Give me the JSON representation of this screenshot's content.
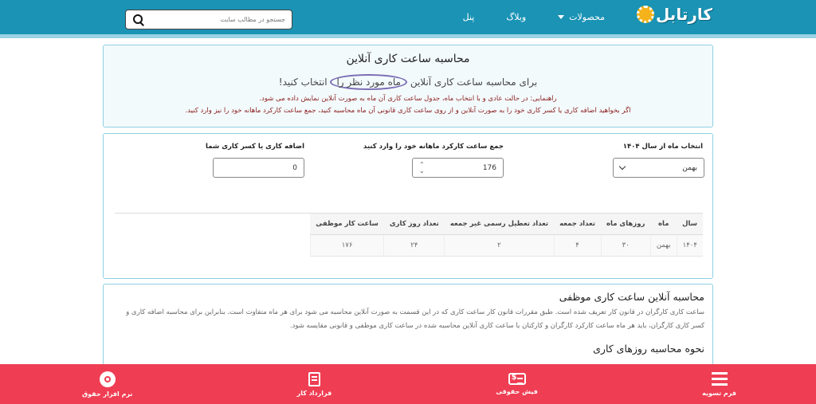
{
  "header": {
    "logo_text": "کارتابل",
    "nav": [
      {
        "label": "محصولات"
      },
      {
        "label": "وبلاگ"
      },
      {
        "label": "پنل"
      }
    ],
    "search": {
      "placeholder": "جستجو در مطالب سایت"
    }
  },
  "intro": {
    "title": "محاسبه ساعت کاری آنلاین",
    "subtitle_before": "برای محاسبه ساعت کاری آنلاین",
    "subtitle_highlight": "ماه مورد نظر را",
    "subtitle_after": "انتخاب کنید!",
    "hint1": "راهنمایی: در حالت عادی و با انتخاب ماه، جدول ساعت کاری آن ماه به صورت آنلاین نمایش داده می شود.",
    "hint2": "اگر بخواهید اضافه کاری یا کسر کاری خود را به صورت آنلاین و از روی ساعت کاری قانونی آن ماه محاسبه کنید، جمع ساعت کارکرد ماهانه خود را نیز وارد کنید."
  },
  "form": {
    "month_label": "انتخاب ماه از سال ۱۴۰۴",
    "month_value": "بهمن",
    "hours_label": "جمع ساعت کارکرد ماهانه خود را وارد کنید",
    "hours_value": "176",
    "extra_label": "اضافه کاری یا کسر کاری شما",
    "extra_value": "0"
  },
  "table": {
    "headers": [
      "سال",
      "ماه",
      "روزهای ماه",
      "تعداد جمعه",
      "تعداد تعطیل رسمی غیر جمعه",
      "تعداد روز کاری",
      "ساعت کار موظفی"
    ],
    "rows": [
      [
        "۱۴۰۴",
        "بهمن",
        "۳۰",
        "۴",
        "۲",
        "۲۴",
        "۱۷۶"
      ]
    ]
  },
  "article": {
    "h1": "محاسبه آنلاین ساعت کاری موظفی",
    "p1": "ساعت کاری کارگران در قانون کار تعریف شده است. طبق مقررات قانون کار ساعت کاری که در این قسمت به صورت آنلاین محاسبه می شود برای هر ماه متفاوت است. بنابراین برای محاسبه اضافه کاری و کسر کاری کارگران، باید هر ماه ساعت کارکرد کارگران و کارکنان با ساعت کاری آنلاین محاسبه شده در ساعت کاری موظفی و قانونی مقایسه شود.",
    "h2": "نحوه محاسبه روزهای کاری"
  },
  "bottom_bar": [
    {
      "label": "فرم تسویه",
      "icon": "list-icon"
    },
    {
      "label": "فیش حقوقی",
      "icon": "payslip-icon"
    },
    {
      "label": "قرارداد کار",
      "icon": "contract-icon"
    },
    {
      "label": "نرم افزار حقوق",
      "icon": "software-disc-icon"
    }
  ],
  "colors": {
    "header": "#1a93b5",
    "bottom_bar": "#ef3e53",
    "hint": "#8a1c1c"
  }
}
